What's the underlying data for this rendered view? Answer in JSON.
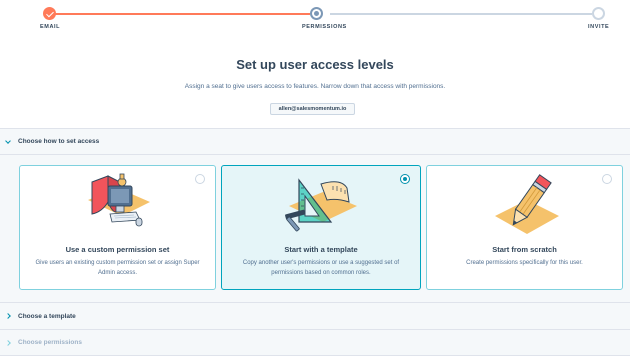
{
  "stepper": {
    "steps": [
      {
        "label": "EMAIL",
        "state": "complete"
      },
      {
        "label": "PERMISSIONS",
        "state": "active"
      },
      {
        "label": "INVITE",
        "state": "pending"
      }
    ]
  },
  "header": {
    "title": "Set up user access levels",
    "subtitle": "Assign a seat to give users access to features. Narrow down that access with permissions.",
    "email": "allen@salesmomentum.io"
  },
  "sections": {
    "access": {
      "label": "Choose how to set access",
      "expanded": true
    },
    "template": {
      "label": "Choose a template",
      "expanded": false
    },
    "permissions": {
      "label": "Choose permissions",
      "expanded": false,
      "disabled": true
    }
  },
  "cards": [
    {
      "title": "Use a custom permission set",
      "description": "Give users an existing custom permission set or assign Super Admin access.",
      "icon": "shield-computer-icon",
      "selected": false
    },
    {
      "title": "Start with a template",
      "description": "Copy another user's permissions or use a suggested set of permissions based on common roles.",
      "icon": "ruler-triangle-hammer-icon",
      "selected": true
    },
    {
      "title": "Start from scratch",
      "description": "Create permissions specifically for this user.",
      "icon": "pencil-icon",
      "selected": false
    }
  ],
  "colors": {
    "accent": "#ff7a59",
    "teal": "#00a4bd",
    "text": "#33475b",
    "selected_bg": "#e5f5f8"
  }
}
